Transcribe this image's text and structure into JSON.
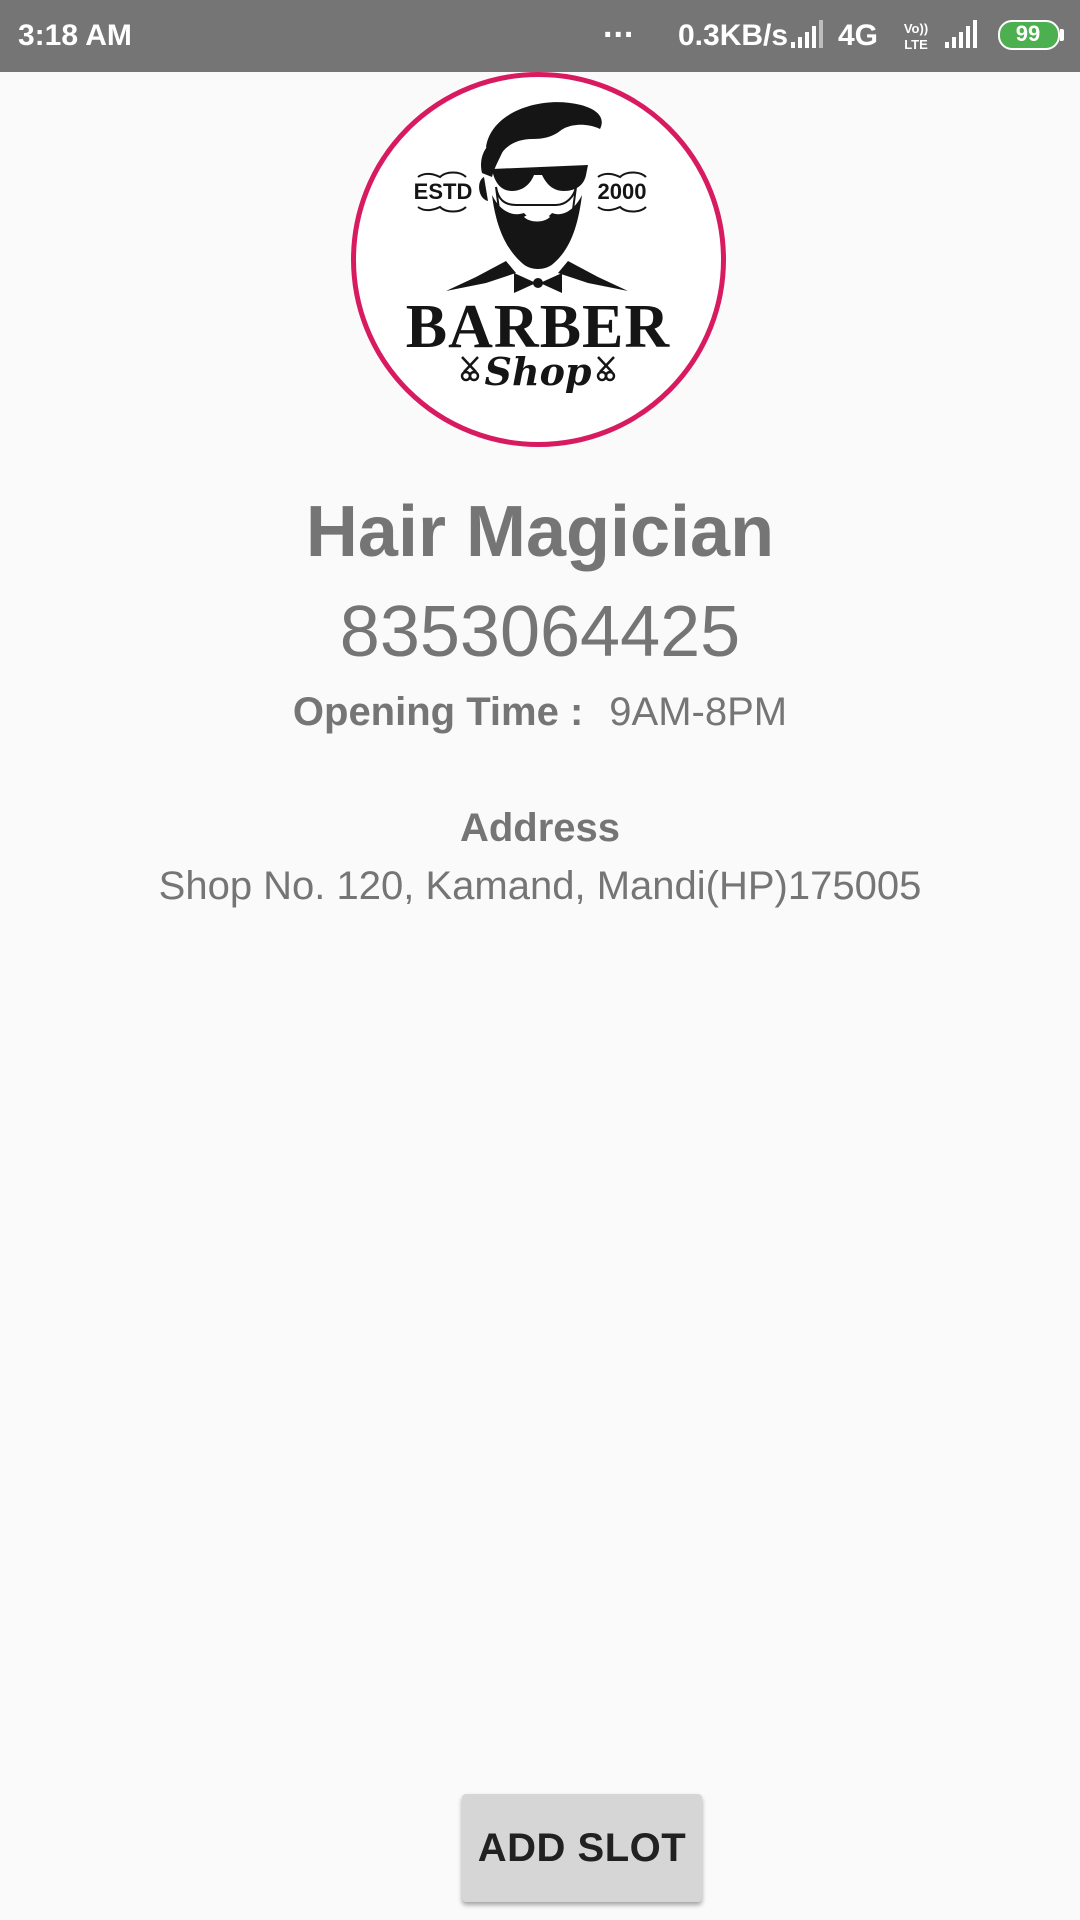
{
  "status_bar": {
    "time": "3:18 AM",
    "dots": "...",
    "speed": "0.3KB/s",
    "network": "4G",
    "volte": "Vo)) LTE",
    "battery": "99",
    "battery_color": "#4caf50",
    "background_color": "#757575",
    "icons": [
      "signal-icon",
      "volte-icon",
      "signal-icon",
      "battery-icon"
    ]
  },
  "shop": {
    "logo": {
      "border_color": "#d81b60",
      "estd": "ESTD",
      "year": "2000",
      "brand": "BARBER",
      "sub": "Shop",
      "icons": [
        "barber-face-icon",
        "scissors-icon"
      ]
    },
    "name": "Hair Magician",
    "phone": "8353064425",
    "opening_label": "Opening Time :",
    "opening_value": "9AM-8PM",
    "address_label": "Address",
    "address_value": "Shop No. 120, Kamand, Mandi(HP)175005"
  },
  "actions": {
    "add_slot_label": "ADD SLOT"
  }
}
